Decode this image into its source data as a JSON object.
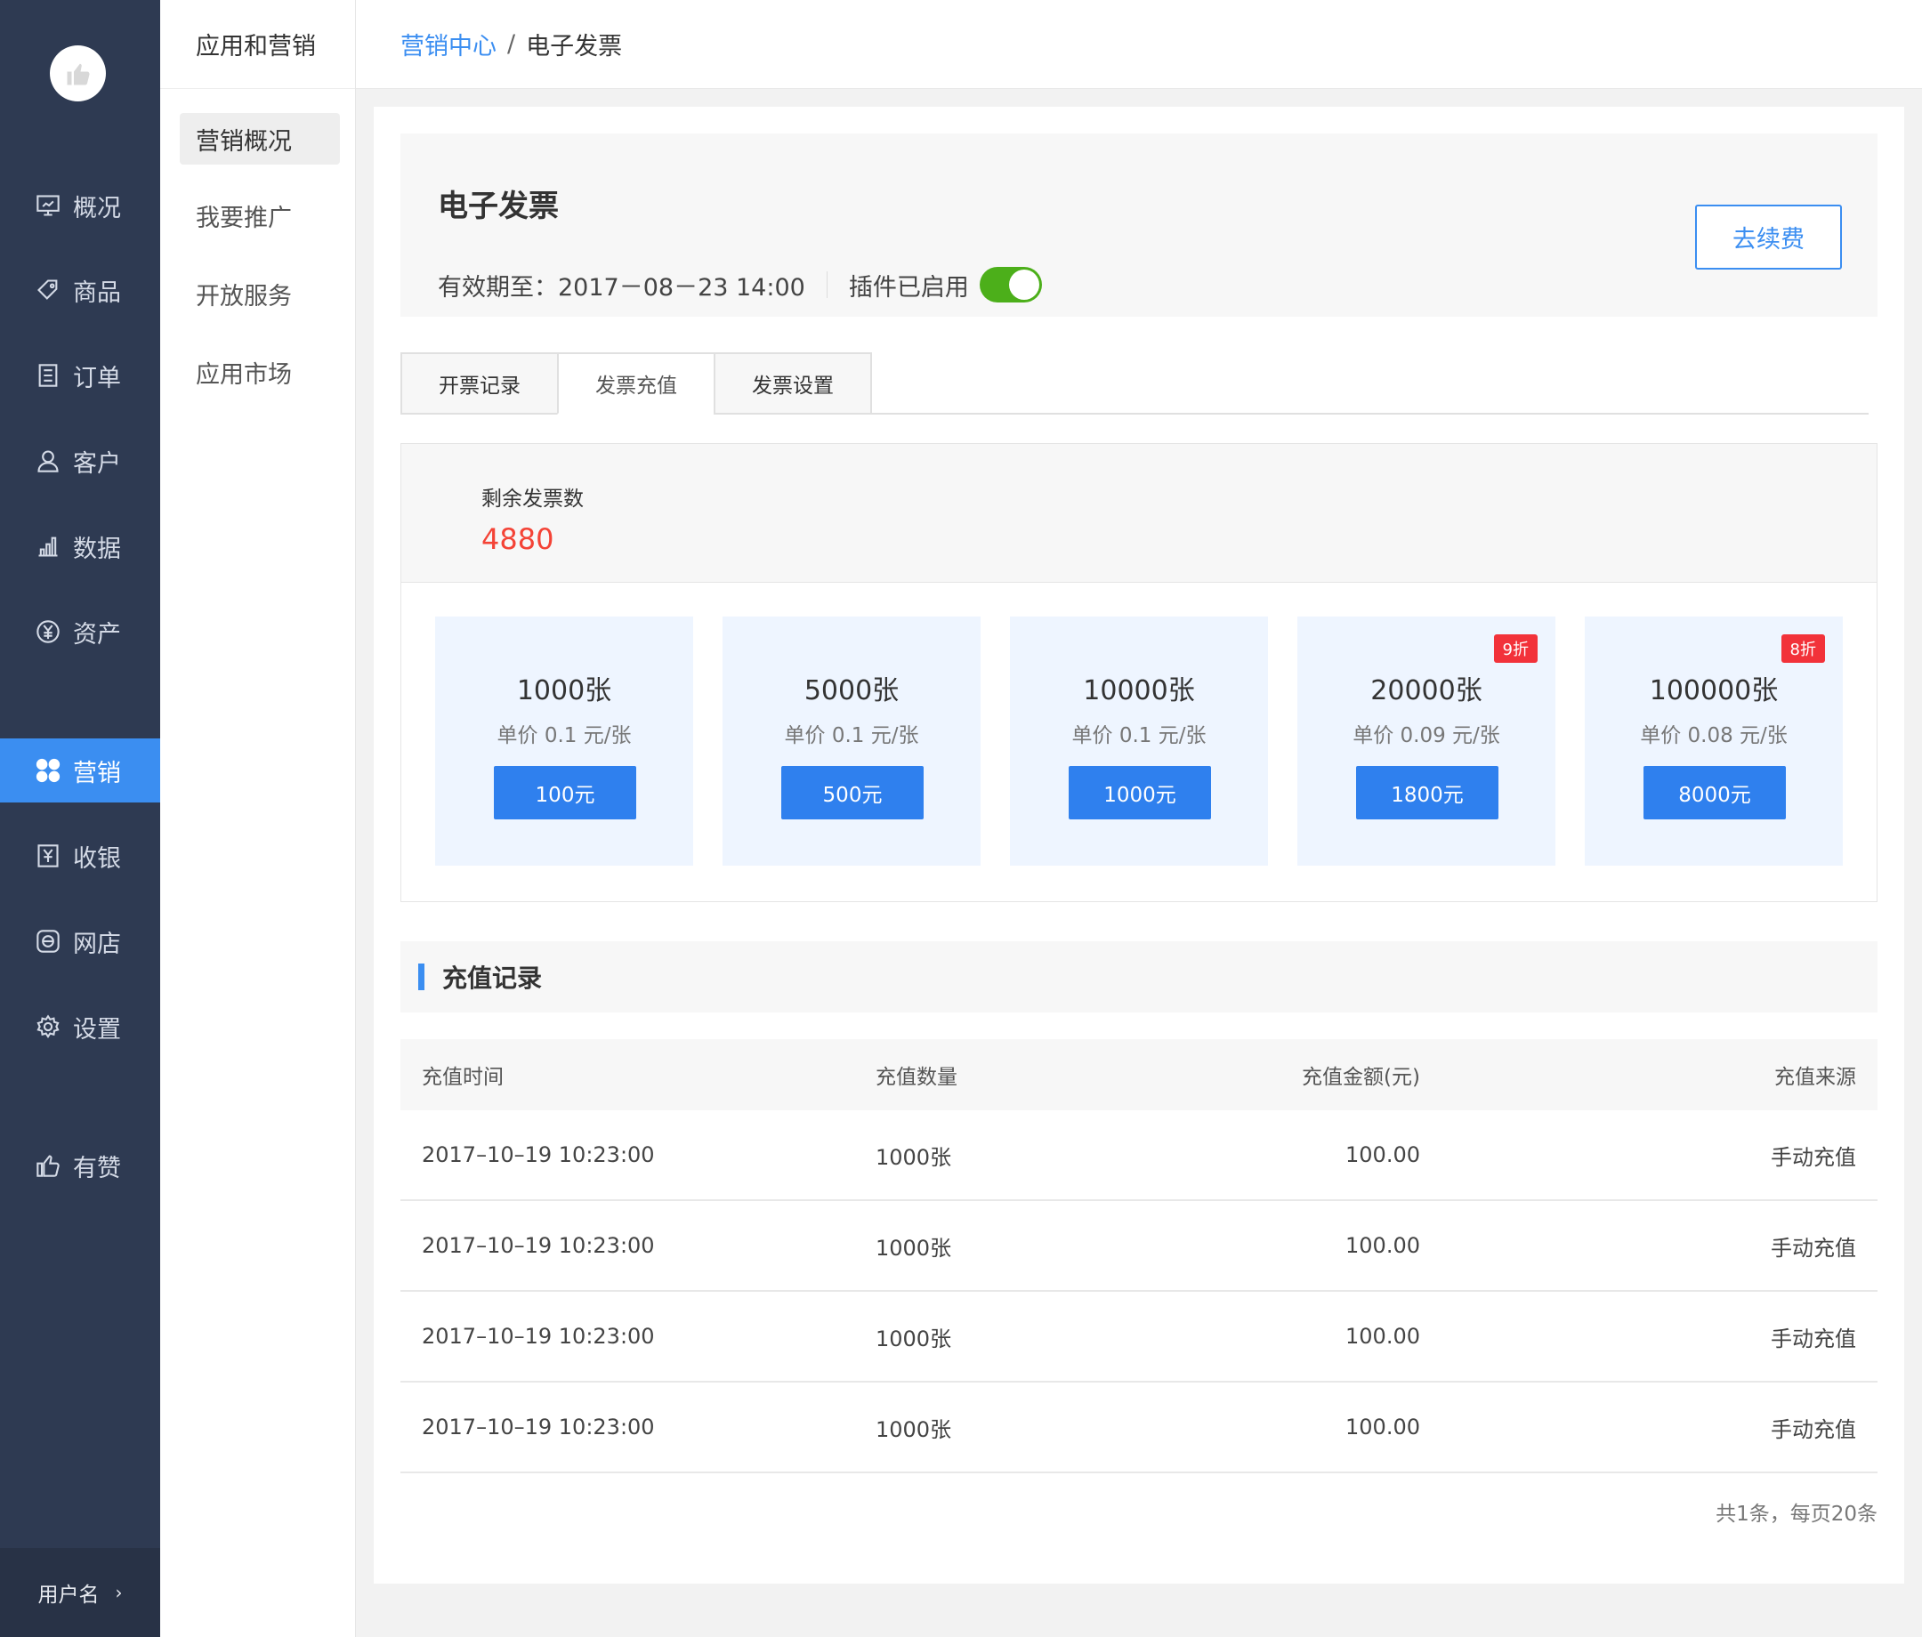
{
  "sidebar": {
    "logo_icon": "thumbs-up-icon",
    "items": [
      {
        "label": "概况",
        "icon": "presentation-icon"
      },
      {
        "label": "商品",
        "icon": "tag-icon"
      },
      {
        "label": "订单",
        "icon": "document-icon"
      },
      {
        "label": "客户",
        "icon": "user-icon"
      },
      {
        "label": "数据",
        "icon": "bar-chart-icon"
      },
      {
        "label": "资产",
        "icon": "yen-circle-icon"
      },
      {
        "label": "营销",
        "icon": "grid-icon"
      },
      {
        "label": "收银",
        "icon": "cashier-icon"
      },
      {
        "label": "网店",
        "icon": "shop-icon"
      },
      {
        "label": "设置",
        "icon": "gear-icon"
      },
      {
        "label": "有赞",
        "icon": "thumbs-up-icon"
      }
    ],
    "active": "营销",
    "user": {
      "label": "用户名",
      "chevron": "›"
    }
  },
  "subnav": {
    "title": "应用和营销",
    "items": [
      "营销概况",
      "我要推广",
      "开放服务",
      "应用市场"
    ],
    "active": "营销概况"
  },
  "breadcrumb": {
    "parent": "营销中心",
    "separator": "/",
    "current": "电子发票"
  },
  "summary": {
    "title": "电子发票",
    "validity": "有效期至：2017－08－23 14:00",
    "plugin_status": "插件已启用",
    "plugin_enabled": true,
    "renew_label": "去续费"
  },
  "tabs": {
    "items": [
      "开票记录",
      "发票充值",
      "发票设置"
    ],
    "active": "发票充值"
  },
  "remaining": {
    "label": "剩余发票数",
    "value": "4880"
  },
  "packages": [
    {
      "qty": "1000张",
      "price": "单价 0.1 元/张",
      "button": "100元",
      "badge": ""
    },
    {
      "qty": "5000张",
      "price": "单价 0.1 元/张",
      "button": "500元",
      "badge": ""
    },
    {
      "qty": "10000张",
      "price": "单价 0.1 元/张",
      "button": "1000元",
      "badge": ""
    },
    {
      "qty": "20000张",
      "price": "单价 0.09 元/张",
      "button": "1800元",
      "badge": "9折"
    },
    {
      "qty": "100000张",
      "price": "单价 0.08 元/张",
      "button": "8000元",
      "badge": "8折"
    }
  ],
  "records": {
    "title": "充值记录",
    "columns": [
      "充值时间",
      "充值数量",
      "充值金额(元)",
      "充值来源"
    ],
    "rows": [
      [
        "2017–10–19 10:23:00",
        "1000张",
        "100.00",
        "手动充值"
      ],
      [
        "2017–10–19 10:23:00",
        "1000张",
        "100.00",
        "手动充值"
      ],
      [
        "2017–10–19 10:23:00",
        "1000张",
        "100.00",
        "手动充值"
      ],
      [
        "2017–10–19 10:23:00",
        "1000张",
        "100.00",
        "手动充值"
      ]
    ],
    "pagination": "共1条，每页20条"
  },
  "colors": {
    "sidebar_bg": "#2e3a52",
    "accent": "#3b8ef1",
    "button_blue": "#2f80ee",
    "toggle_on": "#4caf1a",
    "remaining_red": "#f44336",
    "badge_red": "#f2323a",
    "package_bg": "#eef5ff"
  }
}
